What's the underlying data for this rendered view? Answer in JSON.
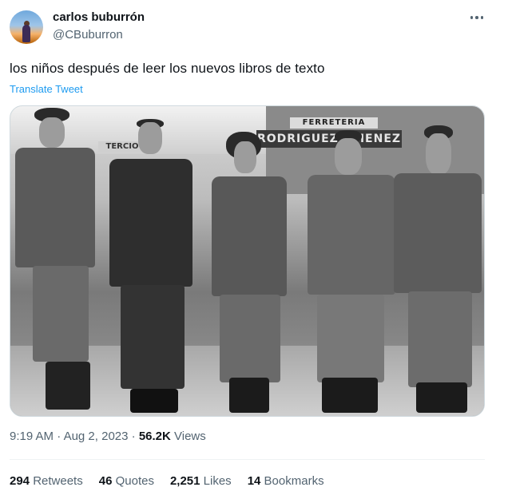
{
  "author": {
    "display_name": "carlos buburrón",
    "handle": "@CBuburron",
    "avatar_icon": "profile-avatar"
  },
  "more_icon": "more-horizontal-icon",
  "tweet": {
    "text": "los niños después de leer los nuevos libros de texto",
    "translate_label": "Translate Tweet"
  },
  "media": {
    "sign_top": "FERRETERIA",
    "sign_main": "RODRIGUEZ JIMENEZ",
    "sign_left": "TERCIO"
  },
  "meta": {
    "time": "9:19 AM",
    "sep1": " · ",
    "date": "Aug 2, 2023",
    "sep2": " · ",
    "views_count": "56.2K",
    "views_label": " Views"
  },
  "stats": {
    "retweets_count": "294",
    "retweets_label": " Retweets",
    "quotes_count": "46",
    "quotes_label": " Quotes",
    "likes_count": "2,251",
    "likes_label": " Likes",
    "bookmarks_count": "14",
    "bookmarks_label": " Bookmarks"
  },
  "colors": {
    "link": "#1d9bf0",
    "secondary_text": "#536471",
    "primary_text": "#0f1419"
  }
}
